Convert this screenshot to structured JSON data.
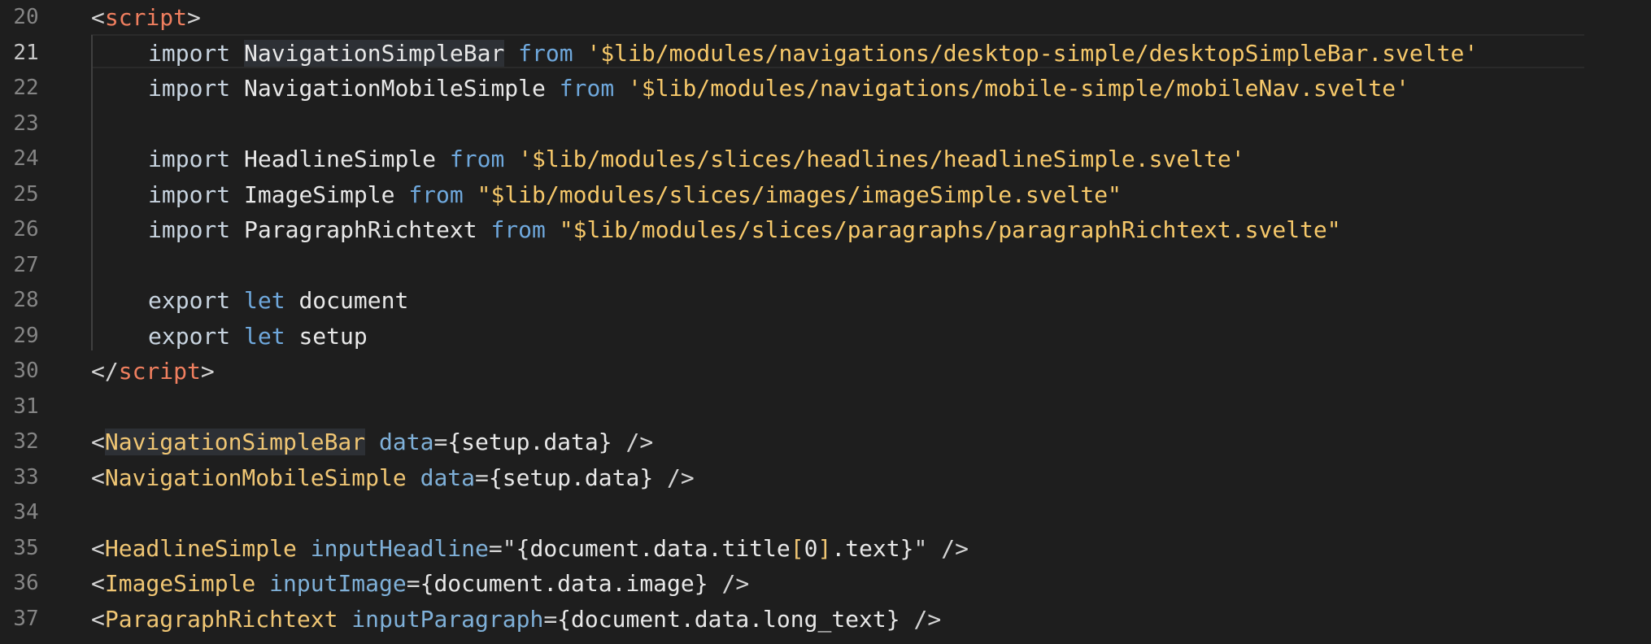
{
  "colors": {
    "background": "#1e1e1e",
    "line_number": "#858585",
    "tag": "#f07f5f",
    "component": "#f0c674",
    "string": "#f6c86a",
    "keyword_let": "#6fa8dc",
    "attribute": "#7fb0d8"
  },
  "editor": {
    "active_line": "21",
    "lines": [
      {
        "n": "20",
        "lt": "<",
        "tag": "script",
        "gt": ">"
      },
      {
        "n": "21",
        "kw": "import",
        "name": "NavigationSimpleBar",
        "from": "from",
        "path": "'$lib/modules/navigations/desktop-simple/desktopSimpleBar.svelte'"
      },
      {
        "n": "22",
        "kw": "import",
        "name": "NavigationMobileSimple",
        "from": "from",
        "path": "'$lib/modules/navigations/mobile-simple/mobileNav.svelte'"
      },
      {
        "n": "23"
      },
      {
        "n": "24",
        "kw": "import",
        "name": "HeadlineSimple",
        "from": "from",
        "path": "'$lib/modules/slices/headlines/headlineSimple.svelte'"
      },
      {
        "n": "25",
        "kw": "import",
        "name": "ImageSimple",
        "from": "from",
        "path": "\"$lib/modules/slices/images/imageSimple.svelte\""
      },
      {
        "n": "26",
        "kw": "import",
        "name": "ParagraphRichtext",
        "from": "from",
        "path": "\"$lib/modules/slices/paragraphs/paragraphRichtext.svelte\""
      },
      {
        "n": "27"
      },
      {
        "n": "28",
        "kw": "export",
        "let": "let",
        "name": "document"
      },
      {
        "n": "29",
        "kw": "export",
        "let": "let",
        "name": "setup"
      },
      {
        "n": "30",
        "lt": "</",
        "tag": "script",
        "gt": ">"
      },
      {
        "n": "31"
      },
      {
        "n": "32",
        "lt": "<",
        "comp": "NavigationSimpleBar",
        "attr": "data",
        "eq": "=",
        "value": "{setup.data}",
        "close": " />"
      },
      {
        "n": "33",
        "lt": "<",
        "comp": "NavigationMobileSimple",
        "attr": "data",
        "eq": "=",
        "value": "{setup.data}",
        "close": " />"
      },
      {
        "n": "34"
      },
      {
        "n": "35",
        "lt": "<",
        "comp": "HeadlineSimple",
        "attr": "inputHeadline",
        "eq": "=",
        "q1": "\"",
        "v1": "{document.data.title",
        "b1": "[",
        "idx": "0",
        "b2": "]",
        "v2": ".text}",
        "q2": "\"",
        "close": " />"
      },
      {
        "n": "36",
        "lt": "<",
        "comp": "ImageSimple",
        "attr": "inputImage",
        "eq": "=",
        "value": "{document.data.image}",
        "close": " />"
      },
      {
        "n": "37",
        "lt": "<",
        "comp": "ParagraphRichtext",
        "attr": "inputParagraph",
        "eq": "=",
        "value": "{document.data.long_text}",
        "close": " />"
      }
    ]
  }
}
